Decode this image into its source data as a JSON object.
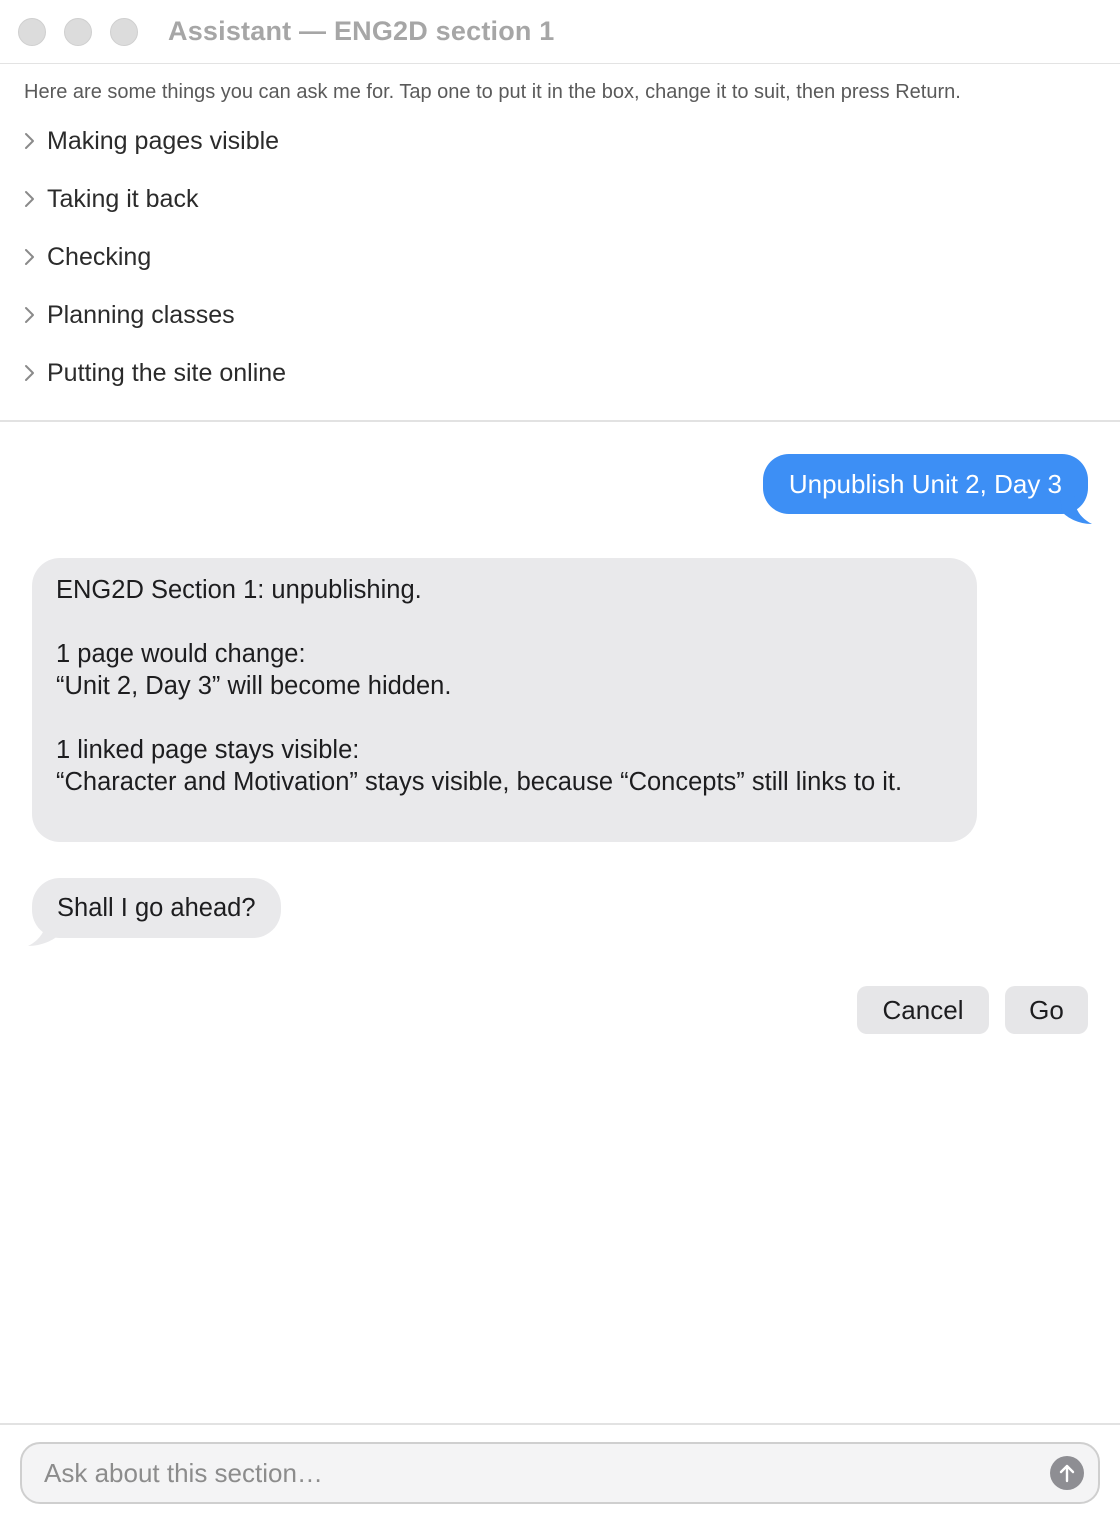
{
  "window": {
    "title": "Assistant — ENG2D section 1"
  },
  "suggestions": {
    "intro": "Here are some things you can ask me for. Tap one to put it in the box, change it to suit, then press Return.",
    "items": [
      {
        "label": "Making pages visible",
        "icon": "chevron-right-icon"
      },
      {
        "label": "Taking it back",
        "icon": "chevron-right-icon"
      },
      {
        "label": "Checking",
        "icon": "chevron-right-icon"
      },
      {
        "label": "Planning classes",
        "icon": "chevron-right-icon"
      },
      {
        "label": "Putting the site online",
        "icon": "chevron-right-icon"
      }
    ]
  },
  "conversation": {
    "user_message": "Unpublish Unit 2, Day 3",
    "assistant_reply": {
      "heading": "ENG2D Section 1: unpublishing.",
      "change_title": "1 page would change:",
      "change_detail": "“Unit 2, Day 3” will become hidden.",
      "linked_title": "1 linked page stays visible:",
      "linked_detail": "“Character and Motivation” stays visible, because “Concepts” still links to it."
    },
    "confirm_question": "Shall I go ahead?",
    "actions": {
      "cancel_label": "Cancel",
      "go_label": "Go"
    }
  },
  "composer": {
    "placeholder": "Ask about this section…",
    "value": "",
    "send_icon": "arrow-up-icon"
  },
  "colors": {
    "user_bubble": "#3d8ff5",
    "assistant_bubble": "#e9e9eb",
    "button_bg": "#e6e6e8",
    "send_button": "#8e8e93"
  }
}
